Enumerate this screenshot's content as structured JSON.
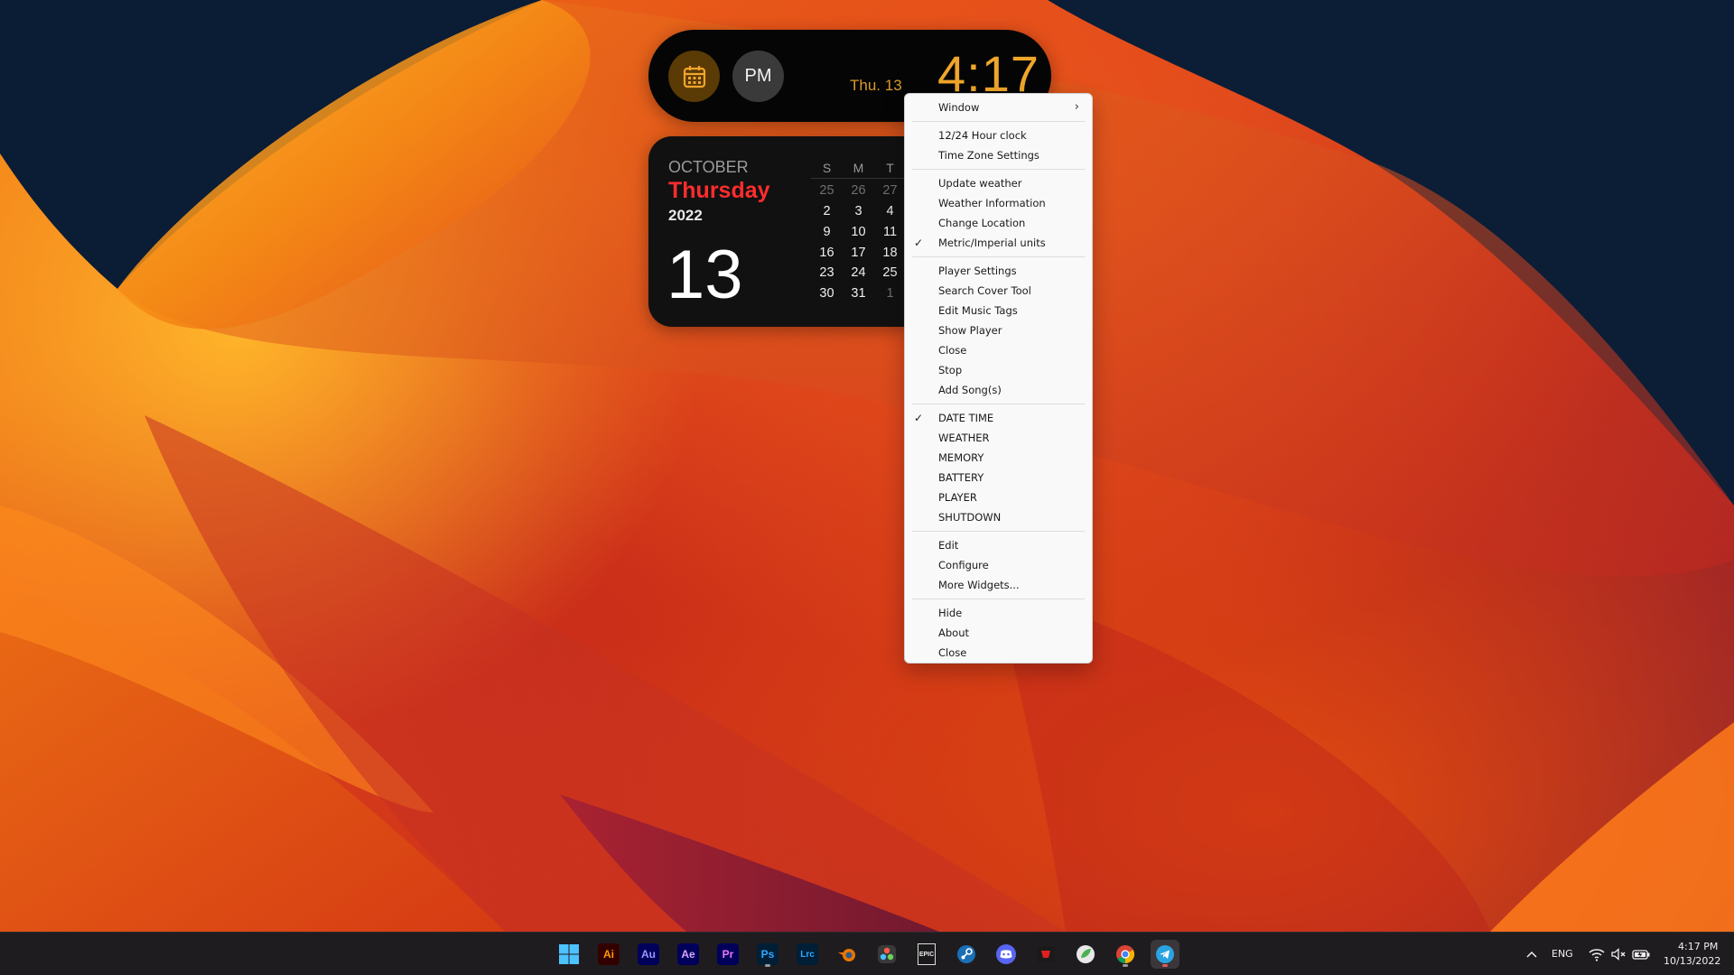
{
  "clock_widget": {
    "period": "PM",
    "date": "Thu. 13",
    "time": "4:17"
  },
  "calendar_widget": {
    "month": "OCTOBER",
    "weekday": "Thursday",
    "year": "2022",
    "day": "13",
    "headers": [
      "S",
      "M",
      "T"
    ],
    "rows": [
      [
        "25",
        "26",
        "27"
      ],
      [
        "2",
        "3",
        "4"
      ],
      [
        "9",
        "10",
        "11"
      ],
      [
        "16",
        "17",
        "18"
      ],
      [
        "23",
        "24",
        "25"
      ],
      [
        "30",
        "31",
        "1"
      ]
    ]
  },
  "context_menu": {
    "window": "Window",
    "hour_clock": "12/24 Hour clock",
    "time_zone": "Time Zone Settings",
    "update_weather": "Update weather",
    "weather_info": "Weather Information",
    "change_location": "Change Location",
    "units": "Metric/Imperial units",
    "player_settings": "Player Settings",
    "search_cover": "Search Cover Tool",
    "edit_tags": "Edit Music Tags",
    "show_player": "Show Player",
    "close_player": "Close",
    "stop": "Stop",
    "add_songs": "Add Song(s)",
    "date_time": "DATE TIME",
    "weather": "WEATHER",
    "memory": "MEMORY",
    "battery": "BATTERY",
    "player": "PLAYER",
    "shutdown": "SHUTDOWN",
    "edit": "Edit",
    "configure": "Configure",
    "more_widgets": "More Widgets...",
    "hide": "Hide",
    "about": "About",
    "close": "Close"
  },
  "taskbar": {
    "apps": [
      {
        "name": "windows-start",
        "label": ""
      },
      {
        "name": "illustrator",
        "label": "Ai"
      },
      {
        "name": "audition",
        "label": "Au"
      },
      {
        "name": "after-effects",
        "label": "Ae"
      },
      {
        "name": "premiere",
        "label": "Pr"
      },
      {
        "name": "photoshop",
        "label": "Ps"
      },
      {
        "name": "lightroom",
        "label": "Lrc"
      },
      {
        "name": "epic-games",
        "label": "EPIC"
      }
    ],
    "language": "ENG",
    "time": "4:17 PM",
    "date": "10/13/2022"
  }
}
